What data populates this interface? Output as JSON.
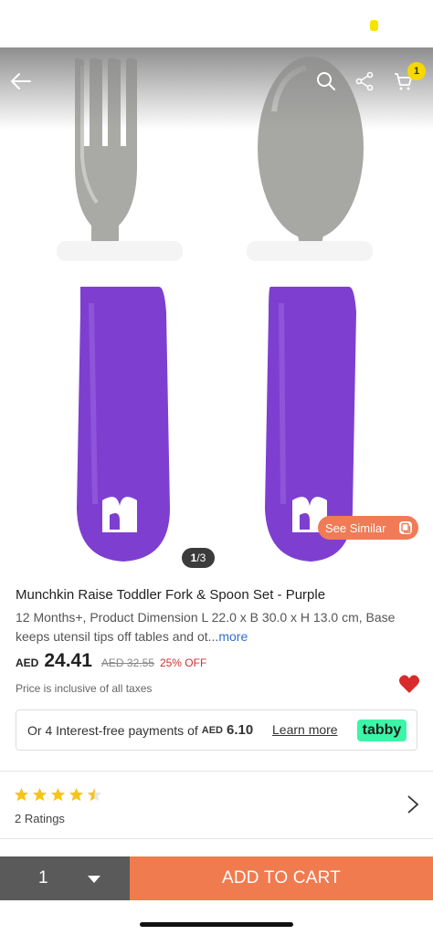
{
  "gallery": {
    "pager_current": "1",
    "pager_total": "/3",
    "see_similar_label": "See Similar"
  },
  "header": {
    "cart_count": "1",
    "icons": [
      "back-arrow-icon",
      "search-icon",
      "share-icon",
      "cart-icon"
    ]
  },
  "product": {
    "title": "Munchkin Raise Toddler Fork & Spoon Set - Purple",
    "description": "12 Months+, Product Dimension L 22.0 x B 30.0 x H 13.0 cm, Base keeps utensil tips off tables and ot...",
    "more_label": "more",
    "currency": "AED",
    "price": "24.41",
    "old_price": "AED 32.55",
    "discount": "25% OFF",
    "tax_note": "Price is inclusive of all taxes"
  },
  "installments": {
    "prefix": "Or 4 Interest-free payments of",
    "currency": "AED",
    "amount": "6.10",
    "learn_more": "Learn more",
    "provider_logo": "tabby"
  },
  "rating": {
    "stars": 4.5,
    "count_label": "2 Ratings"
  },
  "bottom_bar": {
    "quantity": "1",
    "add_to_cart": "ADD TO CART"
  },
  "colors": {
    "accent": "#f07b4f",
    "product_purple": "#7e3fd0",
    "star": "#f5c518",
    "heart": "#d92b2b",
    "tabby_green": "#3cf5a6"
  }
}
